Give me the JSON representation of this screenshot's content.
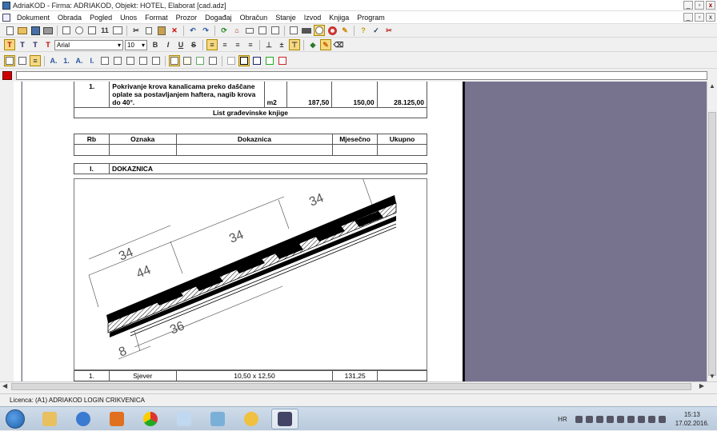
{
  "window": {
    "title": "AdriaKOD - Firma: ADRIAKOD,   Objekt: HOTEL, Elaborat [cad.adz]",
    "min": "_",
    "max": "▫",
    "close": "x"
  },
  "menu": [
    "Dokument",
    "Obrada",
    "Pogled",
    "Unos",
    "Format",
    "Prozor",
    "Događaj",
    "Obračun",
    "Stanje",
    "Izvod",
    "Knjiga",
    "Program"
  ],
  "toolbar2": {
    "font": "Arial",
    "size": "10",
    "bold": "B",
    "italic": "I",
    "underline": "U",
    "strike": "S",
    "page_number": "11"
  },
  "document": {
    "item_row": {
      "rb": "1.",
      "desc_lines": [
        "Pokrivanje krova kanalicama preko daščane",
        "oplate sa postavljanjem haftera, nagib krova",
        "do 40°."
      ],
      "unit": "m2",
      "qty": "187,50",
      "price": "150,00",
      "total": "28.125,00"
    },
    "list_title": "List građevinske knjige",
    "headers": [
      "Rb",
      "Oznaka",
      "Dokaznica",
      "Mjesečno",
      "Ukupno"
    ],
    "section": {
      "rb": "I.",
      "name": "DOKAZNICA"
    },
    "drawing_dims": [
      "34",
      "44",
      "34",
      "34",
      "36",
      "8"
    ],
    "bottom_row": {
      "rb": "1.",
      "oznaka": "Sjever",
      "dokaznica": "10,50 x 12,50",
      "mjesecno": "131,25"
    }
  },
  "status": {
    "licence": "Licenca: (A1) ADRIAKOD LOGIN CRIKVENICA"
  },
  "taskbar": {
    "lang": "HR",
    "time": "15:13",
    "date": "17.02.2016."
  },
  "colors": {
    "doc_bg": "#77738f",
    "accent_red": "#cc0000"
  }
}
